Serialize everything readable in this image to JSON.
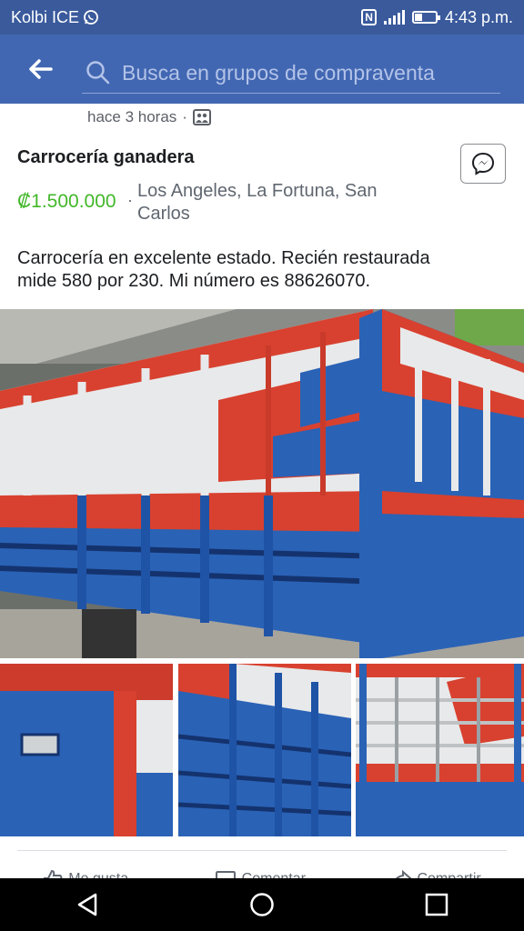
{
  "status_bar": {
    "carrier": "Kolbi ICE",
    "carrier_icon": "whatsapp-icon",
    "nfc_label": "N",
    "battery_level": 0.35,
    "time": "4:43 p.m."
  },
  "header": {
    "back_icon": "back-arrow-icon",
    "search_icon": "search-icon",
    "search_placeholder": "Busca en grupos de compraventa",
    "bg_color": "#4267b2"
  },
  "post": {
    "time": "hace 3 horas",
    "title": "Carrocería ganadera",
    "price": "₡1.500.000",
    "separator": "·",
    "location": "Los Angeles, La Fortuna, San Carlos",
    "description": "Carrocería en excelente estado. Recién restaurada\nmide 580 por 230. Mi número es 88626070.",
    "price_color": "#42b72a"
  },
  "actions": [
    {
      "label": "Me gusta",
      "icon": "like-icon"
    },
    {
      "label": "Comentar",
      "icon": "comment-icon"
    },
    {
      "label": "Compartir",
      "icon": "share-icon"
    }
  ],
  "nav": {
    "back": "nav-back-icon",
    "home": "nav-home-icon",
    "recents": "nav-recents-icon"
  }
}
